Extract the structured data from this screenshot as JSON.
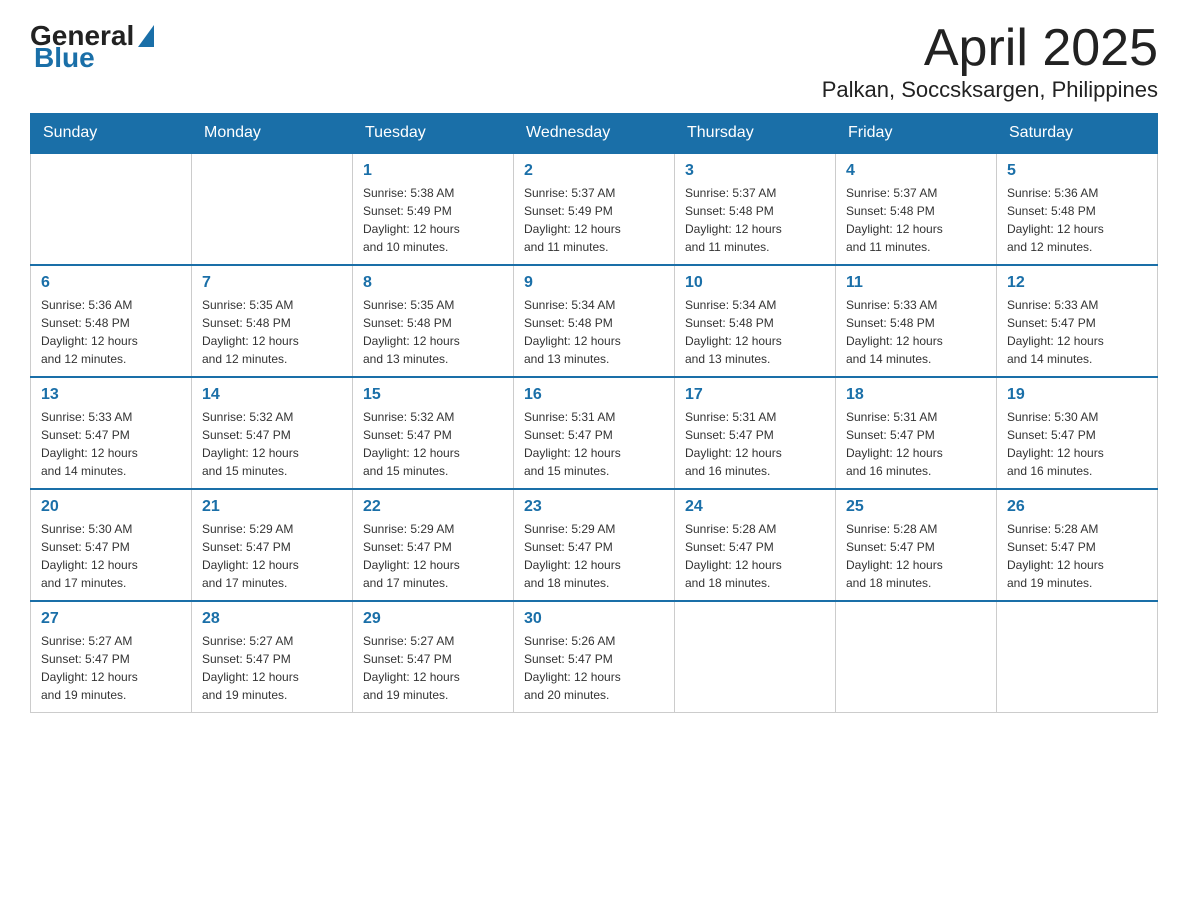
{
  "header": {
    "logo": {
      "general": "General",
      "blue": "Blue"
    },
    "title": "April 2025",
    "subtitle": "Palkan, Soccsksargen, Philippines"
  },
  "calendar": {
    "days": [
      "Sunday",
      "Monday",
      "Tuesday",
      "Wednesday",
      "Thursday",
      "Friday",
      "Saturday"
    ],
    "weeks": [
      [
        {
          "day": "",
          "info": ""
        },
        {
          "day": "",
          "info": ""
        },
        {
          "day": "1",
          "info": "Sunrise: 5:38 AM\nSunset: 5:49 PM\nDaylight: 12 hours\nand 10 minutes."
        },
        {
          "day": "2",
          "info": "Sunrise: 5:37 AM\nSunset: 5:49 PM\nDaylight: 12 hours\nand 11 minutes."
        },
        {
          "day": "3",
          "info": "Sunrise: 5:37 AM\nSunset: 5:48 PM\nDaylight: 12 hours\nand 11 minutes."
        },
        {
          "day": "4",
          "info": "Sunrise: 5:37 AM\nSunset: 5:48 PM\nDaylight: 12 hours\nand 11 minutes."
        },
        {
          "day": "5",
          "info": "Sunrise: 5:36 AM\nSunset: 5:48 PM\nDaylight: 12 hours\nand 12 minutes."
        }
      ],
      [
        {
          "day": "6",
          "info": "Sunrise: 5:36 AM\nSunset: 5:48 PM\nDaylight: 12 hours\nand 12 minutes."
        },
        {
          "day": "7",
          "info": "Sunrise: 5:35 AM\nSunset: 5:48 PM\nDaylight: 12 hours\nand 12 minutes."
        },
        {
          "day": "8",
          "info": "Sunrise: 5:35 AM\nSunset: 5:48 PM\nDaylight: 12 hours\nand 13 minutes."
        },
        {
          "day": "9",
          "info": "Sunrise: 5:34 AM\nSunset: 5:48 PM\nDaylight: 12 hours\nand 13 minutes."
        },
        {
          "day": "10",
          "info": "Sunrise: 5:34 AM\nSunset: 5:48 PM\nDaylight: 12 hours\nand 13 minutes."
        },
        {
          "day": "11",
          "info": "Sunrise: 5:33 AM\nSunset: 5:48 PM\nDaylight: 12 hours\nand 14 minutes."
        },
        {
          "day": "12",
          "info": "Sunrise: 5:33 AM\nSunset: 5:47 PM\nDaylight: 12 hours\nand 14 minutes."
        }
      ],
      [
        {
          "day": "13",
          "info": "Sunrise: 5:33 AM\nSunset: 5:47 PM\nDaylight: 12 hours\nand 14 minutes."
        },
        {
          "day": "14",
          "info": "Sunrise: 5:32 AM\nSunset: 5:47 PM\nDaylight: 12 hours\nand 15 minutes."
        },
        {
          "day": "15",
          "info": "Sunrise: 5:32 AM\nSunset: 5:47 PM\nDaylight: 12 hours\nand 15 minutes."
        },
        {
          "day": "16",
          "info": "Sunrise: 5:31 AM\nSunset: 5:47 PM\nDaylight: 12 hours\nand 15 minutes."
        },
        {
          "day": "17",
          "info": "Sunrise: 5:31 AM\nSunset: 5:47 PM\nDaylight: 12 hours\nand 16 minutes."
        },
        {
          "day": "18",
          "info": "Sunrise: 5:31 AM\nSunset: 5:47 PM\nDaylight: 12 hours\nand 16 minutes."
        },
        {
          "day": "19",
          "info": "Sunrise: 5:30 AM\nSunset: 5:47 PM\nDaylight: 12 hours\nand 16 minutes."
        }
      ],
      [
        {
          "day": "20",
          "info": "Sunrise: 5:30 AM\nSunset: 5:47 PM\nDaylight: 12 hours\nand 17 minutes."
        },
        {
          "day": "21",
          "info": "Sunrise: 5:29 AM\nSunset: 5:47 PM\nDaylight: 12 hours\nand 17 minutes."
        },
        {
          "day": "22",
          "info": "Sunrise: 5:29 AM\nSunset: 5:47 PM\nDaylight: 12 hours\nand 17 minutes."
        },
        {
          "day": "23",
          "info": "Sunrise: 5:29 AM\nSunset: 5:47 PM\nDaylight: 12 hours\nand 18 minutes."
        },
        {
          "day": "24",
          "info": "Sunrise: 5:28 AM\nSunset: 5:47 PM\nDaylight: 12 hours\nand 18 minutes."
        },
        {
          "day": "25",
          "info": "Sunrise: 5:28 AM\nSunset: 5:47 PM\nDaylight: 12 hours\nand 18 minutes."
        },
        {
          "day": "26",
          "info": "Sunrise: 5:28 AM\nSunset: 5:47 PM\nDaylight: 12 hours\nand 19 minutes."
        }
      ],
      [
        {
          "day": "27",
          "info": "Sunrise: 5:27 AM\nSunset: 5:47 PM\nDaylight: 12 hours\nand 19 minutes."
        },
        {
          "day": "28",
          "info": "Sunrise: 5:27 AM\nSunset: 5:47 PM\nDaylight: 12 hours\nand 19 minutes."
        },
        {
          "day": "29",
          "info": "Sunrise: 5:27 AM\nSunset: 5:47 PM\nDaylight: 12 hours\nand 19 minutes."
        },
        {
          "day": "30",
          "info": "Sunrise: 5:26 AM\nSunset: 5:47 PM\nDaylight: 12 hours\nand 20 minutes."
        },
        {
          "day": "",
          "info": ""
        },
        {
          "day": "",
          "info": ""
        },
        {
          "day": "",
          "info": ""
        }
      ]
    ]
  }
}
